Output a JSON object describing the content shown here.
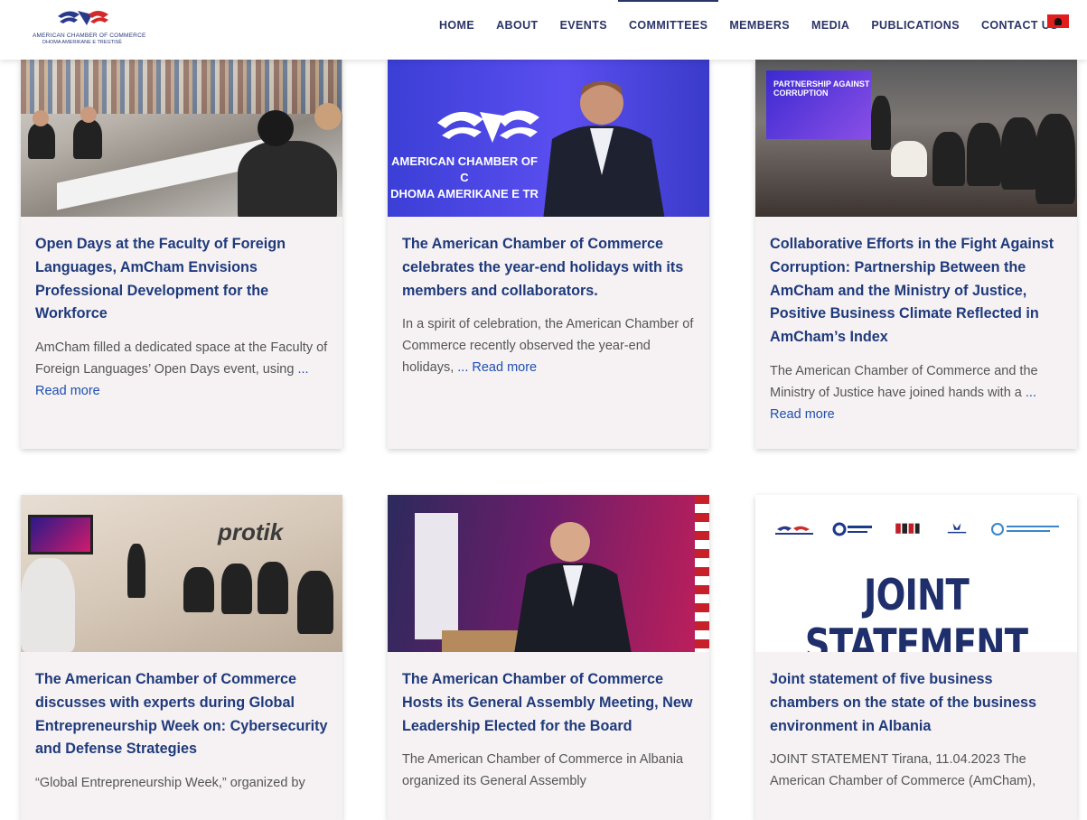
{
  "header": {
    "logo_line1": "AMERICAN CHAMBER OF COMMERCE",
    "logo_line2": "DHOMA AMERIKANE E TREGTISË",
    "nav": [
      {
        "label": "HOME"
      },
      {
        "label": "ABOUT"
      },
      {
        "label": "EVENTS"
      },
      {
        "label": "COMMITTEES"
      },
      {
        "label": "MEMBERS"
      },
      {
        "label": "MEDIA"
      },
      {
        "label": "PUBLICATIONS"
      },
      {
        "label": "CONTACT US"
      }
    ],
    "active_nav": "COMMITTEES",
    "language_flag": "albania-flag-icon"
  },
  "cards": [
    {
      "title": "Open Days at the Faculty of Foreign Languages, AmCham Envisions Professional Development for the Workforce",
      "excerpt": "AmCham filled a dedicated space at the Faculty of Foreign Languages’ Open Days event, using",
      "read_more": "... Read more"
    },
    {
      "title": "The American Chamber of Commerce celebrates the year-end holidays with its members and collaborators.",
      "excerpt": "In a spirit of celebration, the American Chamber of Commerce recently observed the year-end holidays,",
      "read_more": "... Read more",
      "image_text_1": "AMERICAN CHAMBER OF C",
      "image_text_2": "DHOMA AMERIKANE E TR"
    },
    {
      "title": "Collaborative Efforts in the Fight Against Corruption: Partnership Between the AmCham and the Ministry of Justice, Positive Business Climate Reflected in AmCham’s Index",
      "excerpt": "The American Chamber of Commerce and the Ministry of Justice have joined hands with a",
      "read_more": "... Read more",
      "image_text": "PARTNERSHIP AGAINST CORRUPTION"
    },
    {
      "title": "The American Chamber of Commerce discusses with experts during Global Entrepreneurship Week on: Cybersecurity and Defense Strategies",
      "excerpt": "“Global Entrepreneurship Week,” organized by",
      "read_more": "",
      "image_text": "protik"
    },
    {
      "title": "The American Chamber of Commerce Hosts its General Assembly Meeting, New Leadership Elected for the Board",
      "excerpt": "The American Chamber of Commerce in Albania organized its General Assembly",
      "read_more": ""
    },
    {
      "title": "Joint statement of five business chambers on the state of the business environment in Albania",
      "excerpt": "JOINT STATEMENT Tirana, 11.04.2023 The American Chamber of Commerce (AmCham),",
      "read_more": "",
      "image_text": "JOINT STATEMENT"
    }
  ],
  "colors": {
    "nav_text": "#2b3467",
    "title": "#1f3a7c",
    "link": "#1e4fb0",
    "card_bg": "#f6f2f3"
  }
}
